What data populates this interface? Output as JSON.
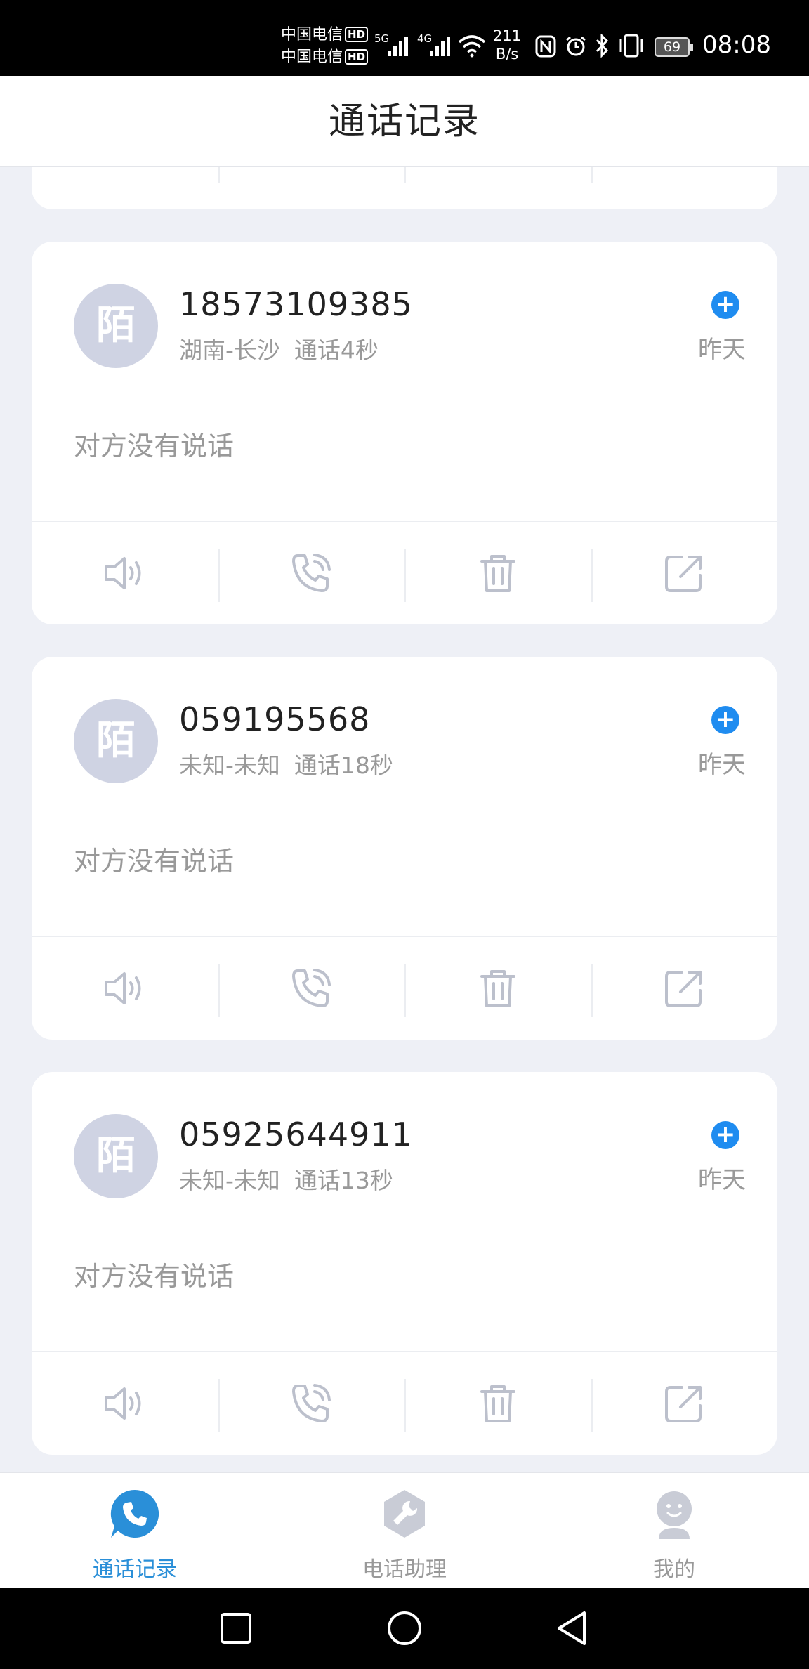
{
  "status_bar": {
    "carrier_1": "中国电信",
    "carrier_2": "中国电信",
    "hd_badge": "HD",
    "sim1_network": "5G",
    "sim2_network": "4G",
    "net_speed_value": "211",
    "net_speed_unit": "B/s",
    "battery": "69",
    "time": "08:08"
  },
  "header": {
    "title": "通话记录"
  },
  "calls": [
    {
      "avatar_char": "陌",
      "number": "18573109385",
      "location": "湖南-长沙",
      "duration": "通话4秒",
      "date": "昨天",
      "transcript": "对方没有说话"
    },
    {
      "avatar_char": "陌",
      "number": "059195568",
      "location": "未知-未知",
      "duration": "通话18秒",
      "date": "昨天",
      "transcript": "对方没有说话"
    },
    {
      "avatar_char": "陌",
      "number": "05925644911",
      "location": "未知-未知",
      "duration": "通话13秒",
      "date": "昨天",
      "transcript": "对方没有说话"
    }
  ],
  "card_actions": [
    "speaker-icon",
    "phone-icon",
    "trash-icon",
    "share-icon"
  ],
  "tabs": [
    {
      "label": "通话记录",
      "icon": "phone-bubble-icon",
      "active": true
    },
    {
      "label": "电话助理",
      "icon": "wrench-icon",
      "active": false
    },
    {
      "label": "我的",
      "icon": "user-icon",
      "active": false
    }
  ],
  "colors": {
    "accent": "#1f8cf0",
    "tab_active": "#2a8fd8",
    "muted": "#999999",
    "background": "#eef0f6"
  }
}
